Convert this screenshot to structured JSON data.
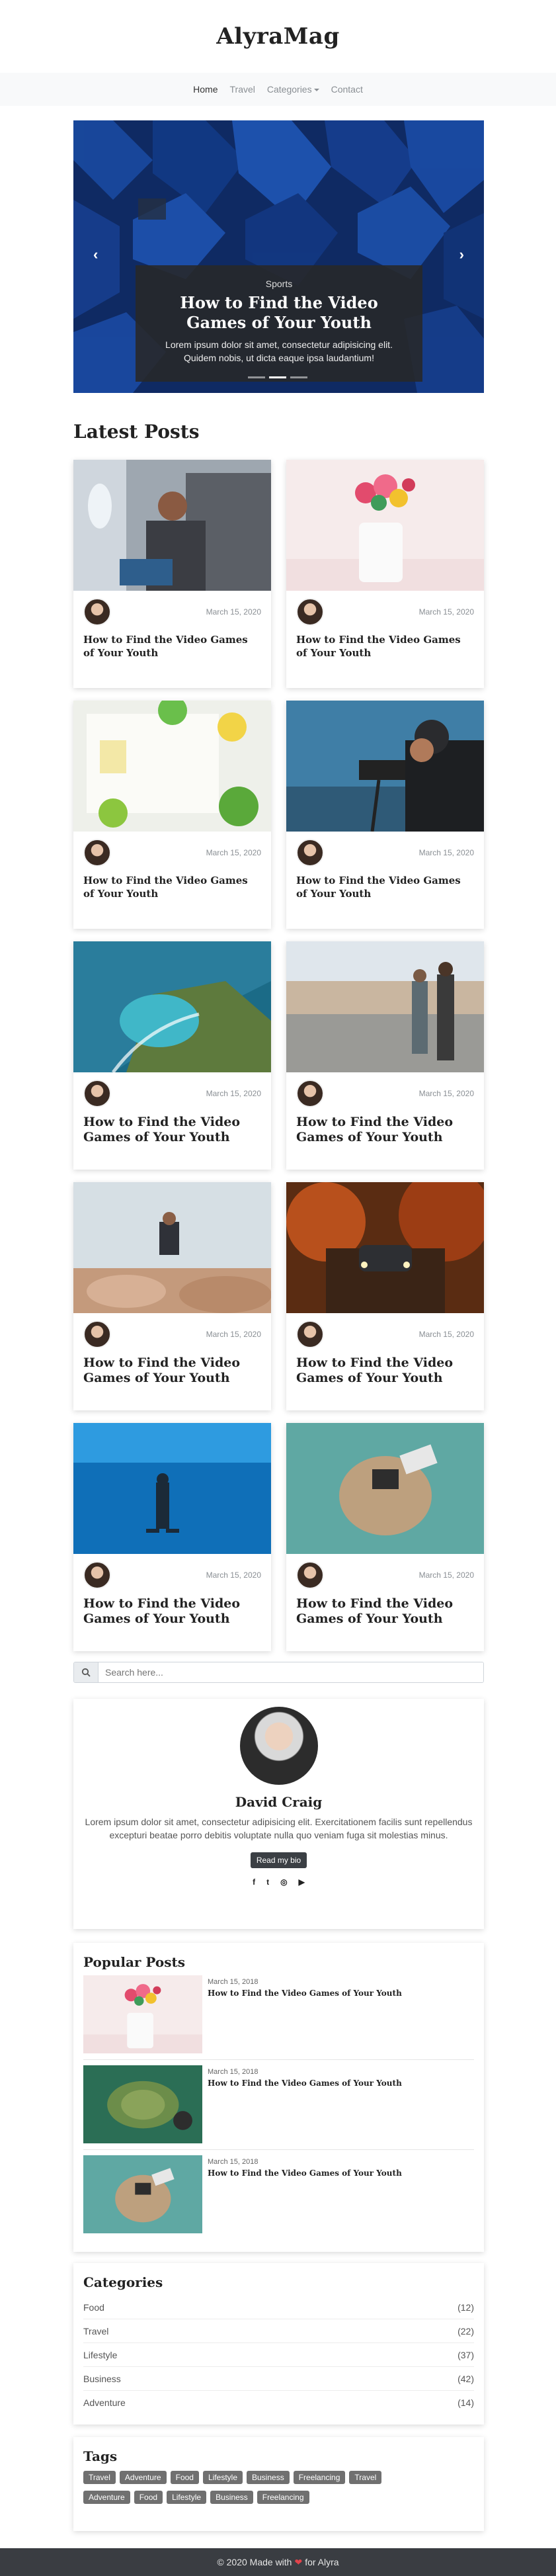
{
  "site": {
    "title": "AlyraMag"
  },
  "nav": {
    "items": [
      {
        "label": "Home"
      },
      {
        "label": "Travel"
      },
      {
        "label": "Categories"
      },
      {
        "label": "Contact"
      }
    ]
  },
  "hero": {
    "category": "Sports",
    "title": "How to Find the Video Games of Your Youth",
    "text": "Lorem ipsum dolor sit amet, consectetur adipisicing elit. Quidem nobis, ut dicta eaque ipsa laudantium!",
    "slide_count": 3,
    "active_slide": 2
  },
  "latest": {
    "heading": "Latest Posts",
    "posts": [
      {
        "date": "March 15, 2020",
        "title": "How to Find the Video Games of Your Youth",
        "image": "man-on-airplane"
      },
      {
        "date": "March 15, 2020",
        "title": "How to Find the Video Games of Your Youth",
        "image": "cactus-vase-with-flowers"
      },
      {
        "date": "March 15, 2020",
        "title": "How to Find the Video Games of Your Youth",
        "image": "book-with-fruit"
      },
      {
        "date": "March 15, 2020",
        "title": "How to Find the Video Games of Your Youth",
        "image": "man-with-camera"
      },
      {
        "date": "March 15, 2020",
        "title": "How to Find the Video Games of Your Youth",
        "image": "aerial-coast"
      },
      {
        "date": "March 15, 2020",
        "title": "How to Find the Video Games of Your Youth",
        "image": "couple-on-promenade"
      },
      {
        "date": "March 15, 2020",
        "title": "How to Find the Video Games of Your Youth",
        "image": "jump-on-rocks"
      },
      {
        "date": "March 15, 2020",
        "title": "How to Find the Video Games of Your Youth",
        "image": "car-in-autumn-forest"
      },
      {
        "date": "March 15, 2020",
        "title": "How to Find the Video Games of Your Youth",
        "image": "diver-underwater"
      },
      {
        "date": "March 15, 2020",
        "title": "How to Find the Video Games of Your Youth",
        "image": "aerial-beach-camera"
      }
    ]
  },
  "search": {
    "placeholder": "Search here..."
  },
  "bio": {
    "name": "David Craig",
    "text": "Lorem ipsum dolor sit amet, consectetur adipisicing elit. Exercitationem facilis sunt repellendus excepturi beatae porro debitis voluptate nulla quo veniam fuga sit molestias minus.",
    "button": "Read my bio",
    "social": [
      {
        "icon": "facebook-icon",
        "glyph": "f"
      },
      {
        "icon": "twitter-icon",
        "glyph": "t"
      },
      {
        "icon": "instagram-icon",
        "glyph": "◎"
      },
      {
        "icon": "youtube-icon",
        "glyph": "▶"
      }
    ]
  },
  "popular": {
    "heading": "Popular Posts",
    "posts": [
      {
        "date": "March 15, 2018",
        "title": "How to Find the Video Games of Your Youth",
        "image": "cactus-vase-with-flowers"
      },
      {
        "date": "March 15, 2018",
        "title": "How to Find the Video Games of Your Youth",
        "image": "turtle-underwater"
      },
      {
        "date": "March 15, 2018",
        "title": "How to Find the Video Games of Your Youth",
        "image": "aerial-beach-camera"
      }
    ]
  },
  "categories": {
    "heading": "Categories",
    "items": [
      {
        "name": "Food",
        "count": "(12)"
      },
      {
        "name": "Travel",
        "count": "(22)"
      },
      {
        "name": "Lifestyle",
        "count": "(37)"
      },
      {
        "name": "Business",
        "count": "(42)"
      },
      {
        "name": "Adventure",
        "count": "(14)"
      }
    ]
  },
  "tags": {
    "heading": "Tags",
    "items": [
      "Travel",
      "Adventure",
      "Food",
      "Lifestyle",
      "Business",
      "Freelancing",
      "Travel",
      "Adventure",
      "Food",
      "Lifestyle",
      "Business",
      "Freelancing"
    ]
  },
  "footer": {
    "prefix": "© 2020 Made with",
    "suffix": "for Alyra",
    "heart_color": "#e2434b"
  }
}
